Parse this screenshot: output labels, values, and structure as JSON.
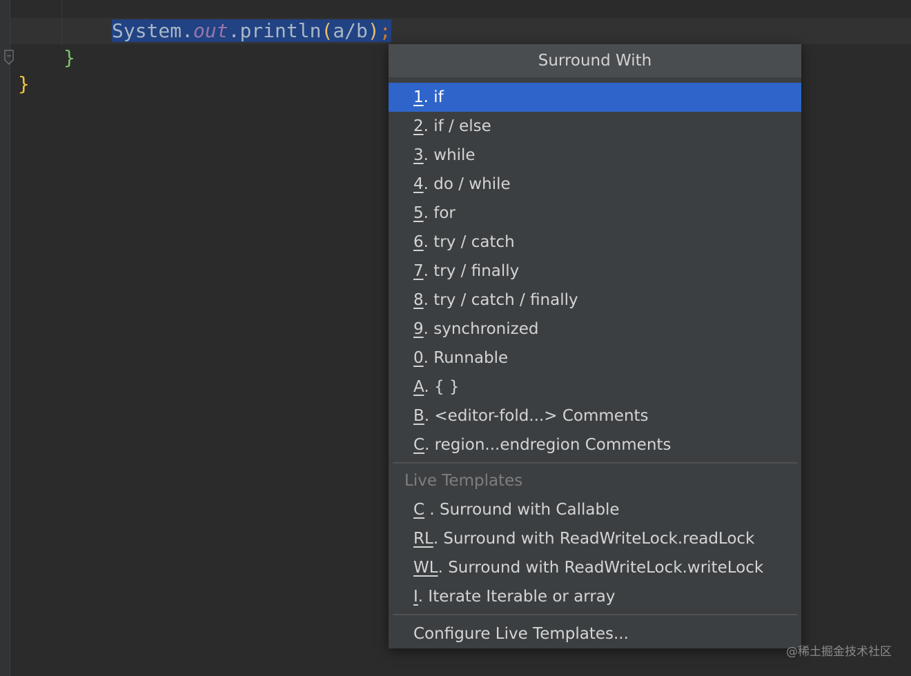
{
  "editor": {
    "code_line_1": {
      "class_name": "System",
      "dot1": ".",
      "field": "out",
      "dot2": ".",
      "method": "println",
      "open_paren": "(",
      "args": "a/b",
      "close_paren": ")",
      "semicolon": ";"
    },
    "code_line_2": "}",
    "code_line_3": "}"
  },
  "popup": {
    "title": "Surround With",
    "items": [
      {
        "key": "1",
        "label": ". if",
        "selected": true
      },
      {
        "key": "2",
        "label": ". if / else"
      },
      {
        "key": "3",
        "label": ". while"
      },
      {
        "key": "4",
        "label": ". do / while"
      },
      {
        "key": "5",
        "label": ". for"
      },
      {
        "key": "6",
        "label": ". try / catch"
      },
      {
        "key": "7",
        "label": ". try / finally"
      },
      {
        "key": "8",
        "label": ". try / catch / finally"
      },
      {
        "key": "9",
        "label": ". synchronized"
      },
      {
        "key": "0",
        "label": ". Runnable"
      },
      {
        "key": "A",
        "label": ". { }"
      },
      {
        "key": "B",
        "label": ". <editor-fold...> Comments"
      },
      {
        "key": "C",
        "label": ". region...endregion Comments"
      }
    ],
    "live_templates_label": "Live Templates",
    "live_templates": [
      {
        "key": "C",
        "rest_key": "",
        "label": " . Surround with Callable"
      },
      {
        "key": "R",
        "rest_key": "L",
        "label": ". Surround with ReadWriteLock.readLock"
      },
      {
        "key": "W",
        "rest_key": "L",
        "label": ". Surround with ReadWriteLock.writeLock"
      },
      {
        "key": "I",
        "rest_key": "",
        "label": ". Iterate Iterable or array"
      }
    ],
    "footer": "Configure Live Templates..."
  },
  "watermark": "@稀土掘金技术社区"
}
